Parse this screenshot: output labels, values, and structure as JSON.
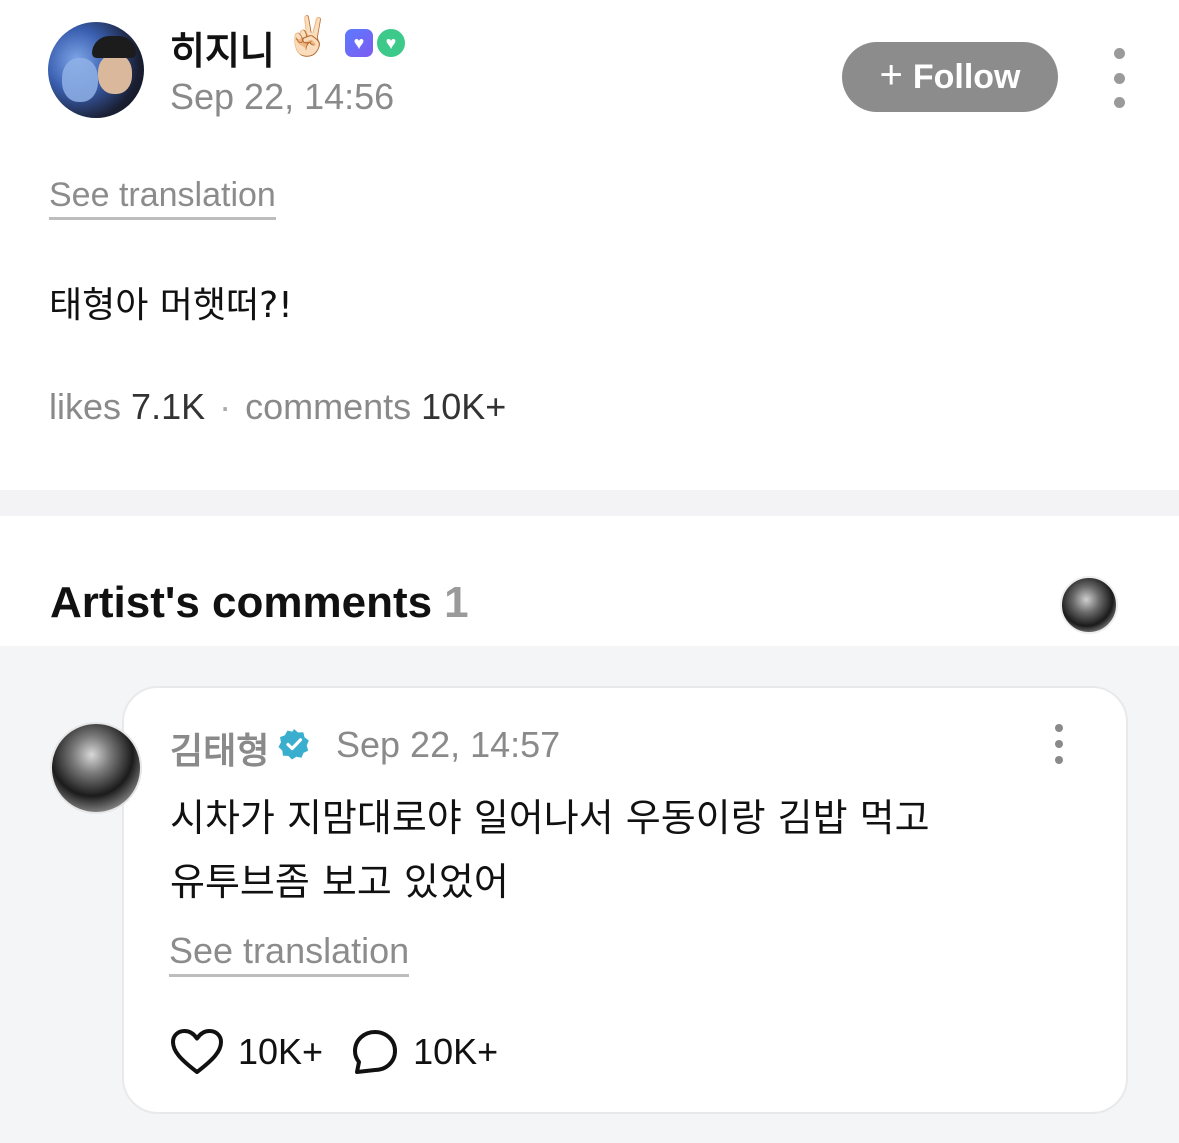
{
  "post": {
    "author": "히지니",
    "author_emoji": "✌🏻",
    "time": "Sep 22, 14:56",
    "follow_label": "Follow",
    "see_translation": "See translation",
    "text": "태형아 머햇떠?!",
    "likes_label": "likes",
    "likes_value": "7.1K",
    "comments_label": "comments",
    "comments_value": "10K+"
  },
  "artist_comments": {
    "title": "Artist's comments",
    "count": "1",
    "comment": {
      "author": "김태형",
      "time": "Sep 22, 14:57",
      "text_line1": "시차가 지맘대로야 일어나서 우동이랑 김밥 먹고",
      "text_line2": "유투브좀 보고 있었어",
      "see_translation": "See translation",
      "likes": "10K+",
      "replies": "10K+"
    }
  },
  "icons": {
    "follow": "plus-icon",
    "more": "more-vertical-icon",
    "verified": "verified-badge-icon",
    "like": "heart-icon",
    "reply": "comment-bubble-icon"
  },
  "colors": {
    "follow_button": "#8c8c8c",
    "verified": "#3aaecf",
    "muted_text": "#8a8a8a",
    "background_gray": "#f4f5f7"
  }
}
